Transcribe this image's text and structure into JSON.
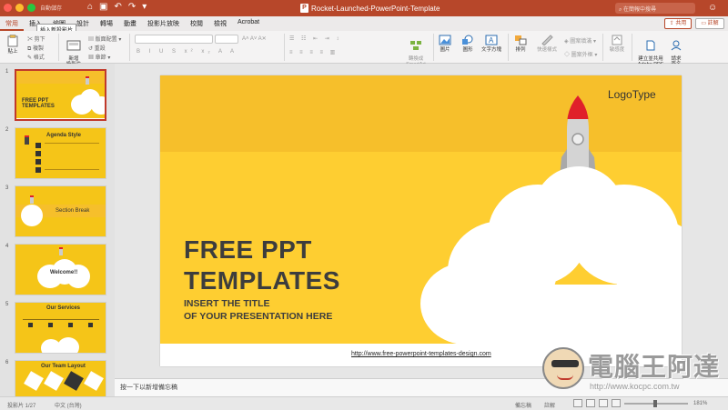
{
  "titlebar": {
    "autosave": "自動儲存",
    "doc_title": "Rocket-Launched-PowerPoint-Template",
    "search_placeholder": "在簡報中搜尋",
    "doc_icon_letter": "P"
  },
  "tabs": [
    {
      "label": "常用",
      "active": true
    },
    {
      "label": "插入"
    },
    {
      "label": "繪圖"
    },
    {
      "label": "設計"
    },
    {
      "label": "轉場"
    },
    {
      "label": "動畫"
    },
    {
      "label": "投影片放映"
    },
    {
      "label": "校閱"
    },
    {
      "label": "檢視"
    },
    {
      "label": "Acrobat"
    }
  ],
  "tooltip": "插入新投影片",
  "share_label": "共用",
  "comment_label": "註解",
  "ribbon": {
    "paste": "貼上",
    "cut": "剪下",
    "copy": "複製",
    "format": "格式",
    "new_slide": "新增\n投影片",
    "layout": "版面配置",
    "reset": "重設",
    "section": "章節",
    "convert_smartart": "轉換成\nSmartArt",
    "picture": "圖片",
    "shapes": "圖形",
    "textbox": "文字方塊",
    "arrange": "排列",
    "quick_styles": "快速樣式",
    "shape_fill": "圖案填滿",
    "shape_outline": "圖案外框",
    "sensitivity": "敏感度",
    "create_pdf": "建立並共用\nAdobe PDF",
    "request_sign": "請求\n簽名"
  },
  "thumbnails": [
    {
      "num": "1",
      "title": "FREE PPT TEMPLATES",
      "selected": true
    },
    {
      "num": "2",
      "title": "Agenda Style"
    },
    {
      "num": "3",
      "title": "Section Break"
    },
    {
      "num": "4",
      "title": "Welcome!!"
    },
    {
      "num": "5",
      "title": "Our Services"
    },
    {
      "num": "6",
      "title": "Our Team Layout"
    }
  ],
  "slide": {
    "logotype": "LogoType",
    "title_line1": "FREE PPT",
    "title_line2": "TEMPLATES",
    "subtitle_line1": "INSERT THE TITLE",
    "subtitle_line2": "OF YOUR PRESENTATION HERE",
    "url": "http://www.free-powerpoint-templates-design.com",
    "colors": {
      "background": "#fece31",
      "band": "#f6bf2b",
      "text": "#3d3d3d",
      "rocket_tip": "#e0202a"
    }
  },
  "notes_placeholder": "按一下以新增備忘稿",
  "status": {
    "slide": "投影片 1/27",
    "language": "中文 (台灣)",
    "notes": "備忘稿",
    "comments": "註解",
    "zoom": "181%"
  },
  "watermark": {
    "text": "電腦王阿達",
    "url": "http://www.kocpc.com.tw"
  }
}
